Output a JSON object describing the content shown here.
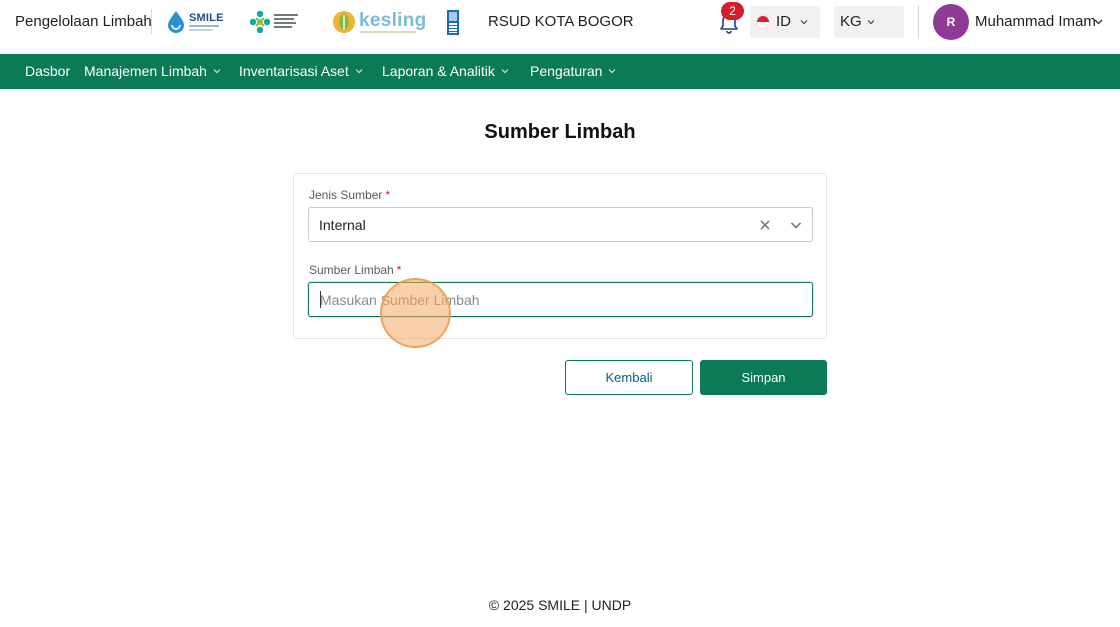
{
  "header": {
    "app_name": "Pengelolaan Limbah",
    "logos": [
      {
        "name": "smile-logo",
        "text": "SMILE"
      },
      {
        "name": "kemenkes-logo",
        "text": "KEMENTERIAN KESEHATAN REPUBLIK INDONESIA"
      },
      {
        "name": "kesling-logo",
        "text": "kesling"
      },
      {
        "name": "undp-logo",
        "text": ""
      }
    ],
    "organization": "RSUD KOTA BOGOR",
    "notifications": {
      "icon": "bell-icon",
      "count": "2"
    },
    "language_select": {
      "value": "ID",
      "icon": "indonesia-flag-icon"
    },
    "unit_select": {
      "value": "KG"
    },
    "user": {
      "initial": "R",
      "name": "Muhammad Imam"
    }
  },
  "nav": {
    "items": [
      {
        "label": "Dasbor",
        "has_dropdown": false
      },
      {
        "label": "Manajemen Limbah",
        "has_dropdown": true
      },
      {
        "label": "Inventarisasi Aset",
        "has_dropdown": true
      },
      {
        "label": "Laporan & Analitik",
        "has_dropdown": true
      },
      {
        "label": "Pengaturan",
        "has_dropdown": true
      }
    ]
  },
  "page": {
    "title": "Sumber Limbah"
  },
  "form": {
    "jenis_sumber": {
      "label": "Jenis Sumber",
      "required_mark": "*",
      "value": "Internal"
    },
    "sumber_limbah": {
      "label": "Sumber Limbah",
      "required_mark": "*",
      "value": "",
      "placeholder": "Masukan Sumber Limbah"
    },
    "buttons": {
      "back": "Kembali",
      "save": "Simpan"
    }
  },
  "footer": {
    "text": "© 2025 SMILE | UNDP"
  },
  "colors": {
    "brand_green": "#0b7a57",
    "badge_red": "#d21f2b",
    "avatar_purple": "#8e3a96",
    "required_red": "#d21f2b"
  }
}
